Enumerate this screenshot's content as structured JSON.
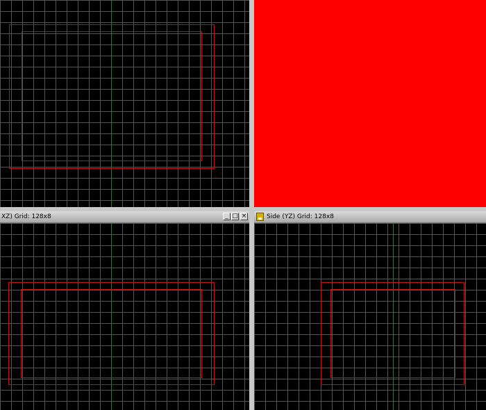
{
  "viewports": {
    "top_left": {
      "type": "wireframe"
    },
    "top_right": {
      "type": "camera",
      "fill_color": "#ff0000"
    },
    "bottom_left": {
      "title": "XZ) Grid: 128x8",
      "buttons": {
        "minimize": "_",
        "maximize": "□",
        "close": "×"
      }
    },
    "bottom_right": {
      "title": "Side (YZ) Grid: 128x8",
      "icon": "app-icon"
    }
  },
  "colors": {
    "viewport_bg": "#000000",
    "grid": "#555555",
    "axis": "#3c6e46",
    "brush": "#c01010",
    "splitter": "#c8c8c8"
  }
}
